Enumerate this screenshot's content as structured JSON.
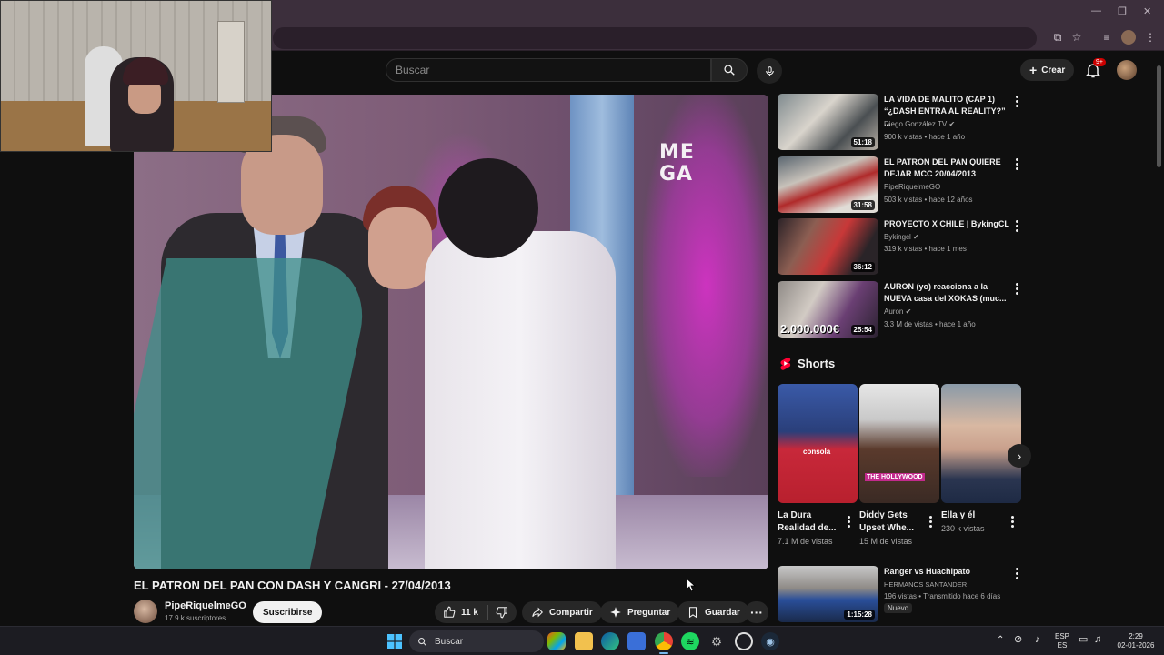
{
  "header": {
    "search_placeholder": "Buscar",
    "create_label": "Crear",
    "notification_count": "9+"
  },
  "video": {
    "title": "EL PATRON DEL PAN CON DASH Y CANGRI - 27/04/2013",
    "overlay_logo_line1": "ME",
    "overlay_logo_line2": "GA",
    "channel_name": "PipeRiquelmeGO",
    "subscribers": "17.9 k suscriptores",
    "subscribe_label": "Suscribirse",
    "likes": "11 k",
    "share_label": "Compartir",
    "ask_label": "Preguntar",
    "save_label": "Guardar"
  },
  "recommendations": [
    {
      "title_line1": "LA VIDA DE MALITO (CAP 1)",
      "title_line2": "“¿DASH ENTRA AL REALITY?” ...",
      "channel": "Diego González TV",
      "verified": true,
      "meta": "900 k vistas • hace 1 año",
      "duration": "51:18"
    },
    {
      "title_line1": "EL PATRON DEL PAN QUIERE",
      "title_line2": "DEJAR MCC 20/04/2013",
      "channel": "PipeRiquelmeGO",
      "verified": false,
      "meta": "503 k vistas • hace 12 años",
      "duration": "31:58"
    },
    {
      "title_line1": "PROYECTO X CHILE  | BykingCL",
      "title_line2": "",
      "channel": "Bykingcl",
      "verified": true,
      "meta": "319 k vistas • hace 1 mes",
      "duration": "36:12"
    },
    {
      "title_line1": "AURON (yo) reacciona a la",
      "title_line2": "NUEVA casa del XOKAS (muc...",
      "channel": "Auron",
      "verified": true,
      "meta": "3.3 M de vistas • hace 1 año",
      "duration": "25:54",
      "thumb_text": "2.000.000€"
    }
  ],
  "shorts": {
    "heading": "Shorts",
    "items": [
      {
        "title_line1": "La Dura",
        "title_line2": "Realidad de...",
        "views": "7.1 M de vistas",
        "thumb_text": "consola"
      },
      {
        "title_line1": "Diddy Gets",
        "title_line2": "Upset Whe...",
        "views": "15 M de vistas",
        "thumb_text": "THE HOLLYWOOD"
      },
      {
        "title_line1": "Ella y él",
        "title_line2": "",
        "views": "230 k vistas",
        "thumb_text": ""
      }
    ]
  },
  "bottom_rec": {
    "title": "Ranger  vs Huachipato",
    "channel": "HERMANOS SANTANDER",
    "meta": "196 vistas • Transmitido hace 6 días",
    "badge": "Nuevo",
    "duration": "1:15:28"
  },
  "taskbar": {
    "search_label": "Buscar",
    "lang_line1": "ESP",
    "lang_line2": "ES",
    "time": "2:29",
    "date": "02-01-2026"
  },
  "colors": {
    "background": "#0f0f0f",
    "pill": "#272727",
    "badge_red": "#cc0000",
    "browser_frame": "#3c2f3c",
    "taskbar": "#1c1c22"
  }
}
